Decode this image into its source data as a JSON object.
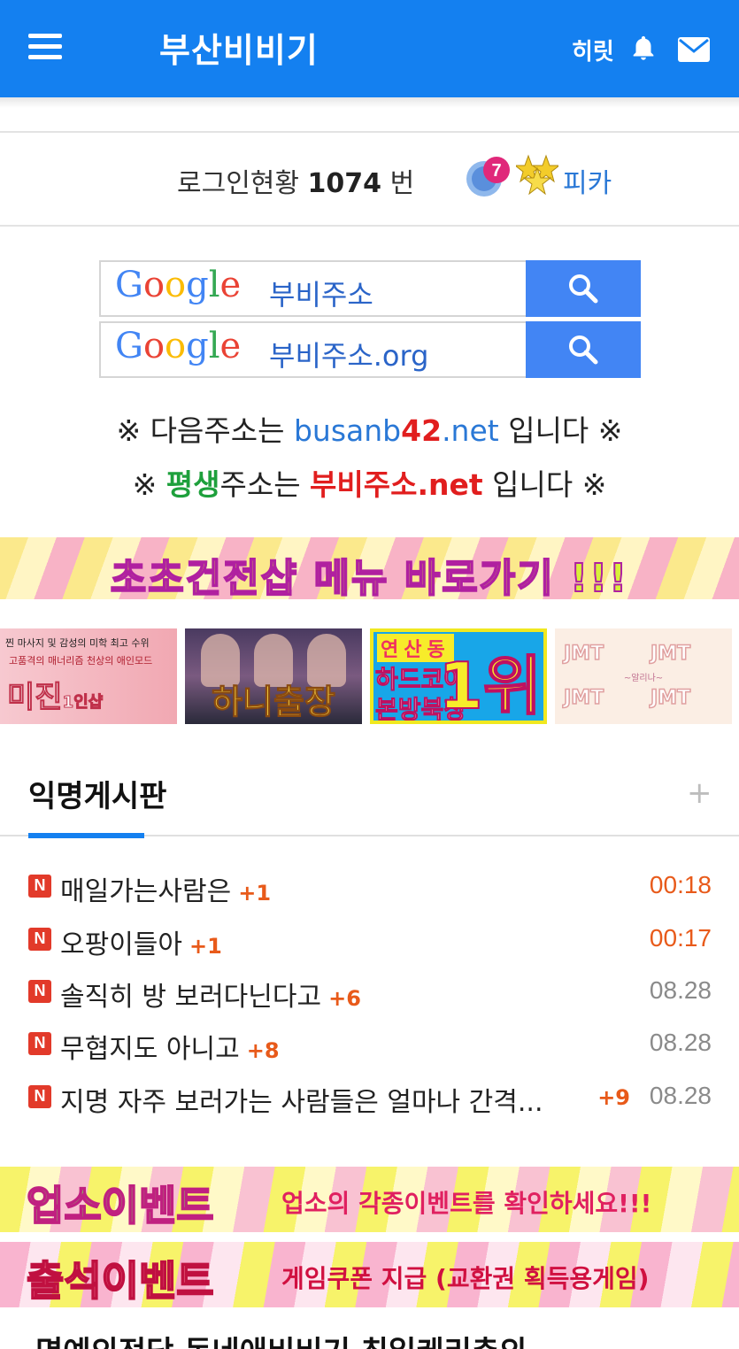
{
  "header": {
    "site_title": "부산비비기",
    "user_name": "히릿",
    "colors": {
      "bar": "#1480f0"
    }
  },
  "login_status": {
    "label": "로그인현황",
    "count": "1074",
    "unit": "번",
    "level": "7",
    "nickname": "피카"
  },
  "search": [
    {
      "logo_parts": [
        "G",
        "o",
        "o",
        "g",
        "l",
        "e"
      ],
      "query": "부비주소",
      "button_icon": "search-icon"
    },
    {
      "logo_parts": [
        "G",
        "o",
        "o",
        "g",
        "l",
        "e"
      ],
      "query": "부비주소.org",
      "button_icon": "search-icon"
    }
  ],
  "notices": {
    "next_prefix": "※ 다음주소는 ",
    "next_domain_a": "busanb",
    "next_domain_b": "42",
    "next_domain_c": ".net",
    "next_suffix": " 입니다 ※",
    "perm_prefix": "※ ",
    "perm_highlight": "평생",
    "perm_mid": "주소는 ",
    "perm_domain": "부비주소.net",
    "perm_suffix": " 입니다 ※"
  },
  "banner_shop": {
    "label": "초초건전샵 메뉴 바로가기 !!!"
  },
  "ads": [
    {
      "line1": "찐 마사지 및 감성의 미학 최고 수위",
      "line2": "고품격의 매너리즘 천상의 애인모드",
      "big": "미진",
      "small": "1인샵"
    },
    {
      "big": "하니출장"
    },
    {
      "l1": "연산동",
      "l2": "하드코어",
      "l3": "본방북창",
      "rank": "1위"
    },
    {
      "jmt": [
        "JMT",
        "JMT",
        "JMT",
        "JMT"
      ],
      "mid": "~알리나~"
    }
  ],
  "board": {
    "title": "익명게시판",
    "more_icon": "plus-icon",
    "posts": [
      {
        "title": "매일가는사람은",
        "count": "+1",
        "date": "00:18",
        "is_new": true
      },
      {
        "title": "오팡이들아",
        "count": "+1",
        "date": "00:17",
        "is_new": true
      },
      {
        "title": "솔직히 방 보러다닌다고",
        "count": "+6",
        "date": "08.28",
        "is_new": false
      },
      {
        "title": "무협지도 아니고",
        "count": "+8",
        "date": "08.28",
        "is_new": false
      },
      {
        "title": "지명 자주 보러가는 사람들은 얼마나 간격...",
        "count": "+9",
        "date": "08.28",
        "is_new": false
      }
    ]
  },
  "event_banners": [
    {
      "title": "업소이벤트",
      "desc": "업소의 각종이벤트를 확인하세요!!!"
    },
    {
      "title": "출석이벤트",
      "desc": "게임쿠폰 지급 (교환권 획득용게임)"
    }
  ],
  "bottom_partial_text": "명예의전당   동네애비비기   최일케리춘의"
}
